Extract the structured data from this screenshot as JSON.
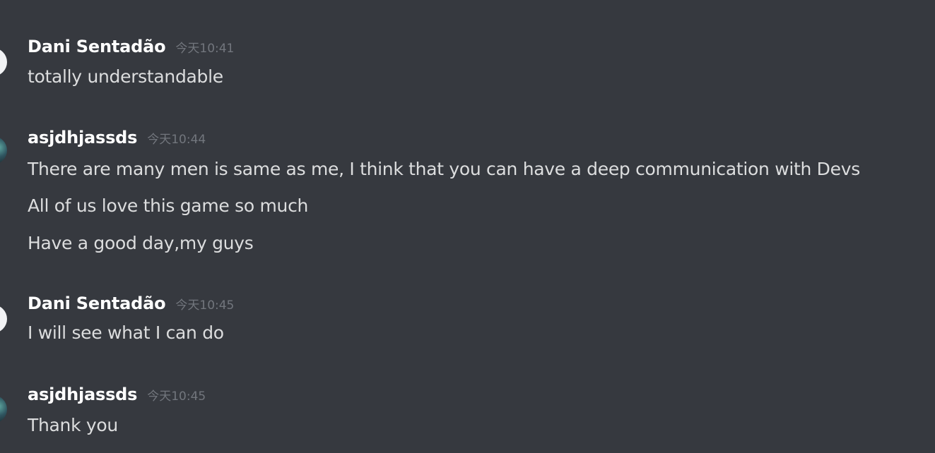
{
  "messages": [
    {
      "author": "Dani Sentadão",
      "timestamp": "今天10:41",
      "avatar": "light-avatar",
      "lines": [
        "totally understandable"
      ]
    },
    {
      "author": "asjdhjassds",
      "timestamp": "今天10:44",
      "avatar": "dark-avatar",
      "lines": [
        "There are many men is same as me, I think that you can have a deep communication with Devs",
        "All of us love this game so much",
        "Have a good day,my guys"
      ]
    },
    {
      "author": "Dani Sentadão",
      "timestamp": "今天10:45",
      "avatar": "light-avatar",
      "lines": [
        "I will see what I can do"
      ]
    },
    {
      "author": "asjdhjassds",
      "timestamp": "今天10:45",
      "avatar": "dark-avatar",
      "lines": [
        "Thank you"
      ]
    }
  ],
  "colors": {
    "background": "#36393f",
    "username": "#ffffff",
    "timestamp": "#72767d",
    "text": "#dcddde"
  }
}
